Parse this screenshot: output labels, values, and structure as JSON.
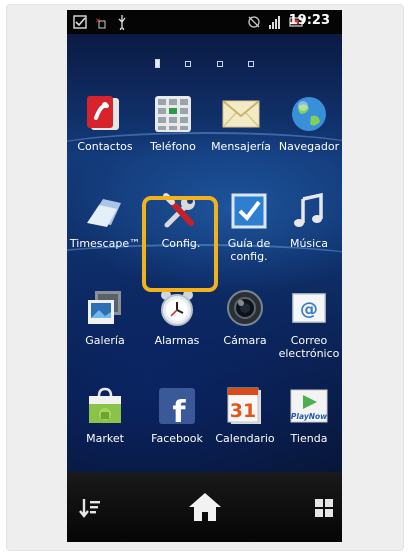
{
  "status_bar": {
    "time": "19:23",
    "left_icons": [
      "checkbox-icon",
      "sim-icon",
      "usb-icon"
    ],
    "right_icons": [
      "rotate-icon",
      "signal-icon",
      "battery-icon"
    ]
  },
  "home": {
    "page_count": 4,
    "active_page": 0
  },
  "apps": [
    {
      "label": "Contactos",
      "icon": "contacts-icon"
    },
    {
      "label": "Teléfono",
      "icon": "phone-keypad-icon"
    },
    {
      "label": "Mensajería",
      "icon": "envelope-icon"
    },
    {
      "label": "Navegador",
      "icon": "globe-icon"
    },
    {
      "label": "Timescape™",
      "icon": "timescape-icon"
    },
    {
      "label": "Config.",
      "icon": "settings-tools-icon"
    },
    {
      "label": "Guía de config.",
      "icon": "setup-guide-icon"
    },
    {
      "label": "Música",
      "icon": "music-note-icon"
    },
    {
      "label": "Galería",
      "icon": "gallery-icon"
    },
    {
      "label": "Alarmas",
      "icon": "alarm-clock-icon"
    },
    {
      "label": "Cámara",
      "icon": "camera-icon"
    },
    {
      "label": "Correo electrónico",
      "icon": "email-icon"
    },
    {
      "label": "Market",
      "icon": "market-bag-icon"
    },
    {
      "label": "Facebook",
      "icon": "facebook-icon"
    },
    {
      "label": "Calendario",
      "icon": "calendar-icon"
    },
    {
      "label": "Tienda",
      "icon": "playnow-store-icon"
    }
  ],
  "calendar_day": "31",
  "store_badge": "PlayNow",
  "highlighted_app": "Config.",
  "nav": {
    "left": "sort-icon",
    "center": "home-icon",
    "right": "apps-grid-icon"
  },
  "colors": {
    "highlight": "#f2b21c",
    "wallpaper": "#133a7a"
  }
}
